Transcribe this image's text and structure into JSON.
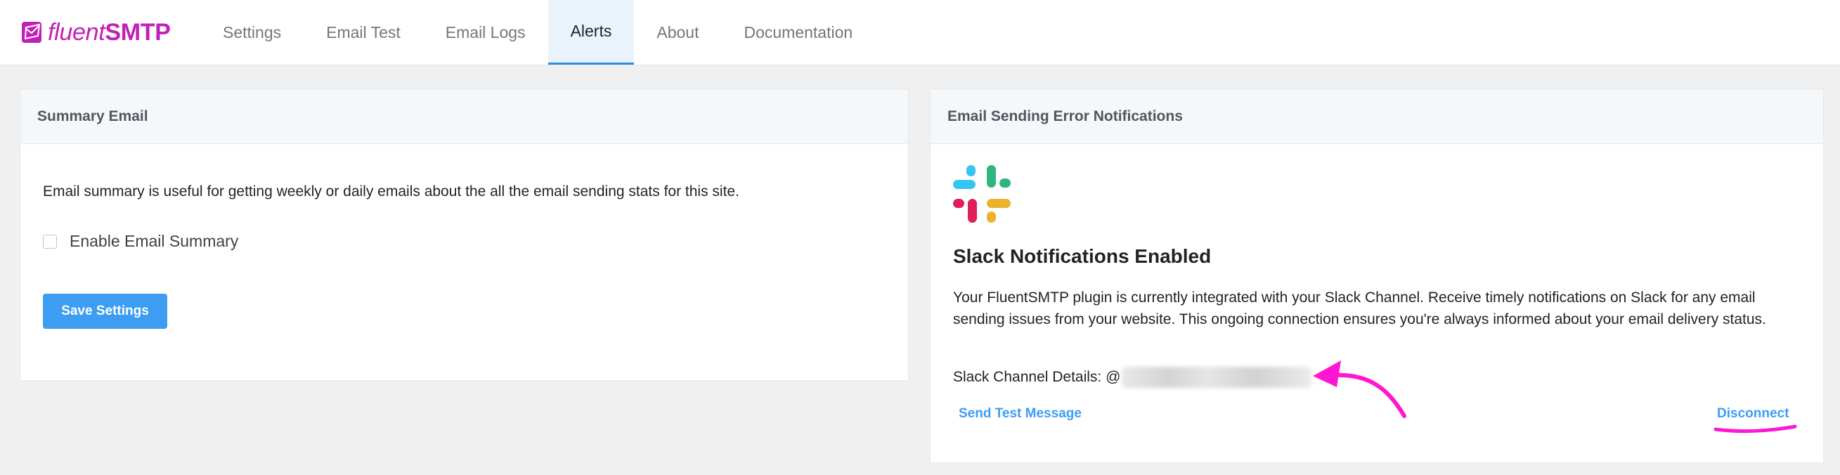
{
  "brand": {
    "name_part1": "fluent",
    "name_part2": "SMTP",
    "color": "#c21fb8"
  },
  "nav": {
    "tabs": [
      {
        "label": "Settings"
      },
      {
        "label": "Email Test"
      },
      {
        "label": "Email Logs"
      },
      {
        "label": "Alerts"
      },
      {
        "label": "About"
      },
      {
        "label": "Documentation"
      }
    ],
    "active_tab": "Alerts"
  },
  "summary_panel": {
    "title": "Summary Email",
    "description": "Email summary is useful for getting weekly or daily emails about the all the email sending stats for this site.",
    "checkbox_label": "Enable Email Summary",
    "checkbox_checked": false,
    "save_label": "Save Settings"
  },
  "error_panel": {
    "title": "Email Sending Error Notifications",
    "slack_icon": "slack-logo-icon",
    "heading": "Slack Notifications Enabled",
    "description": "Your FluentSMTP plugin is currently integrated with your Slack Channel. Receive timely notifications on Slack for any email sending issues from your website. This ongoing connection ensures you're always informed about your email delivery status.",
    "channel_label": "Slack Channel Details: @",
    "send_test_label": "Send Test Message",
    "disconnect_label": "Disconnect"
  },
  "colors": {
    "accent": "#3c9df3",
    "annotation": "#ff16d2",
    "active_tab_bg": "#eaf3fc",
    "active_tab_border": "#2f8de4"
  }
}
